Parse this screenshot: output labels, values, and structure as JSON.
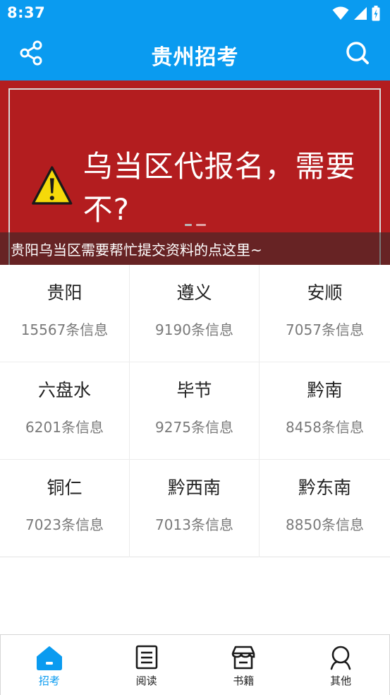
{
  "status": {
    "time": "8:37"
  },
  "app_bar": {
    "title": "贵州招考"
  },
  "banner": {
    "headline": "乌当区代报名，需要不?",
    "caption": "贵阳乌当区需要帮忙提交资料的点这里~"
  },
  "regions": [
    {
      "name": "贵阳",
      "count": "15567条信息"
    },
    {
      "name": "遵义",
      "count": "9190条信息"
    },
    {
      "name": "安顺",
      "count": "7057条信息"
    },
    {
      "name": "六盘水",
      "count": "6201条信息"
    },
    {
      "name": "毕节",
      "count": "9275条信息"
    },
    {
      "name": "黔南",
      "count": "8458条信息"
    },
    {
      "name": "铜仁",
      "count": "7023条信息"
    },
    {
      "name": "黔西南",
      "count": "7013条信息"
    },
    {
      "name": "黔东南",
      "count": "8850条信息"
    }
  ],
  "tabs": [
    {
      "label": "招考",
      "icon": "home-icon",
      "active": true
    },
    {
      "label": "阅读",
      "icon": "reader-icon",
      "active": false
    },
    {
      "label": "书籍",
      "icon": "store-icon",
      "active": false
    },
    {
      "label": "其他",
      "icon": "person-icon",
      "active": false
    }
  ],
  "colors": {
    "primary": "#0a9bf0",
    "banner_red": "#b31d1f",
    "warning_yellow": "#f5d90a"
  }
}
